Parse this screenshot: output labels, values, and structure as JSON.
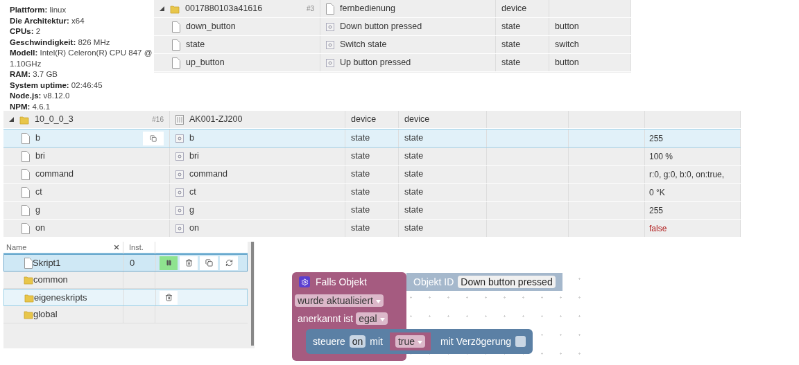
{
  "system_info": [
    {
      "label": "Plattform:",
      "value": "linux"
    },
    {
      "label": "Die Architektur:",
      "value": "x64"
    },
    {
      "label": "CPUs:",
      "value": "2"
    },
    {
      "label": "Geschwindigkeit:",
      "value": "826 MHz"
    },
    {
      "label": "Modell:",
      "value": "Intel(R) Celeron(R) CPU 847 @ 1.10GHz"
    },
    {
      "label": "RAM:",
      "value": "3.7 GB"
    },
    {
      "label": "System uptime:",
      "value": "02:46:45"
    },
    {
      "label": "Node.js:",
      "value": "v8.12.0"
    },
    {
      "label": "NPM:",
      "value": "4.6.1"
    }
  ],
  "objects_table_1": {
    "folder": {
      "id": "0017880103a41616",
      "count": "#3",
      "name": "fernbedienung",
      "type": "device"
    },
    "rows": [
      {
        "id": "down_button",
        "name": "Down button pressed",
        "type": "state",
        "role": "button"
      },
      {
        "id": "state",
        "name": "Switch state",
        "type": "state",
        "role": "switch"
      },
      {
        "id": "up_button",
        "name": "Up button pressed",
        "type": "state",
        "role": "button"
      }
    ]
  },
  "objects_table_2": {
    "folder": {
      "id": "10_0_0_3",
      "count": "#16",
      "name": "AK001-ZJ200",
      "type": "device",
      "role": "device"
    },
    "rows": [
      {
        "id": "b",
        "name": "b",
        "type": "state",
        "role": "state",
        "value": "255",
        "kind": "text",
        "selected": true
      },
      {
        "id": "bri",
        "name": "bri",
        "type": "state",
        "role": "state",
        "value": "100 %",
        "kind": "text",
        "selected": false
      },
      {
        "id": "command",
        "name": "command",
        "type": "state",
        "role": "state",
        "value": "r:0, g:0, b:0, on:true,",
        "kind": "text",
        "selected": false
      },
      {
        "id": "ct",
        "name": "ct",
        "type": "state",
        "role": "state",
        "value": "0 °K",
        "kind": "text",
        "selected": false
      },
      {
        "id": "g",
        "name": "g",
        "type": "state",
        "role": "state",
        "value": "255",
        "kind": "text",
        "selected": false
      },
      {
        "id": "on",
        "name": "on",
        "type": "state",
        "role": "state",
        "value": "false",
        "kind": "boolean",
        "selected": false
      }
    ]
  },
  "scripts": {
    "columns": [
      "Name",
      "Inst."
    ],
    "items": [
      {
        "name": "Skript1",
        "kind": "script",
        "instances": "0",
        "selected": true,
        "hovered": false,
        "running": true
      },
      {
        "name": "common",
        "kind": "folder",
        "selected": false,
        "hovered": false
      },
      {
        "name": "eigeneskripts",
        "kind": "folder",
        "selected": false,
        "hovered": true
      },
      {
        "name": "global",
        "kind": "folder",
        "selected": false,
        "hovered": false
      }
    ]
  },
  "blockly": {
    "trigger": {
      "title": "Falls Objekt",
      "object_label": "Objekt ID",
      "object_value": "Down button pressed",
      "event": "wurde aktualisiert",
      "ack_label": "anerkannt ist",
      "ack_value": "egal"
    },
    "action": {
      "label": "steuere",
      "target": "on",
      "with": "mit",
      "value": "true",
      "delay_label": "mit Verzögerung",
      "delay_checked": false
    }
  }
}
